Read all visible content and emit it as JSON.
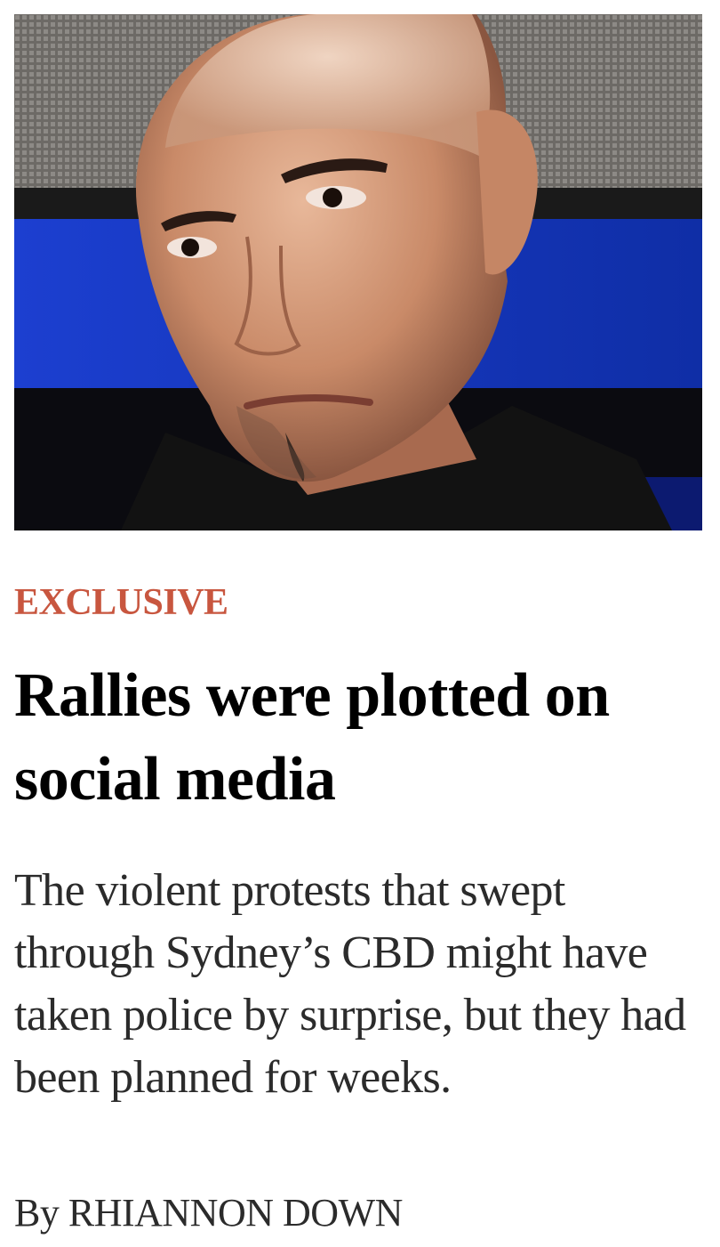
{
  "article": {
    "image_alt": "Portrait photo of a young man with a shaved head",
    "kicker": "EXCLUSIVE",
    "headline": "Rallies were plotted on social media",
    "standfirst": "The violent protests that swept through Sydney’s CBD might have taken police by surprise, but they had been planned for weeks.",
    "byline_prefix": "By",
    "byline_author": "RHIANNON DOWN"
  },
  "colors": {
    "kicker": "#c8563f",
    "headline": "#000000",
    "body": "#2b2b2b"
  }
}
